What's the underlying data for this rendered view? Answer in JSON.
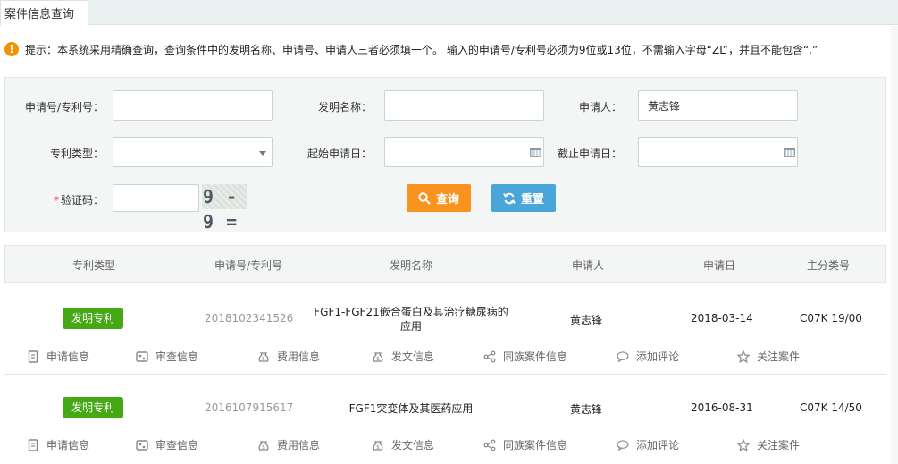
{
  "tab": {
    "label": "案件信息查询"
  },
  "tip": {
    "icon": "warning-icon",
    "text": "提示：本系统采用精确查询，查询条件中的发明名称、申请号、申请人三者必须填一个。 输入的申请号/专利号必须为9位或13位，不需输入字母“ZL”，并且不能包含“.”"
  },
  "form": {
    "app_no_label": "申请号/专利号：",
    "app_no_value": "",
    "invention_label": "发明名称：",
    "invention_value": "",
    "applicant_label": "申请人：",
    "applicant_value": "黄志锋",
    "type_label": "专利类型：",
    "type_selected": "",
    "start_label": "起始申请日：",
    "start_value": "",
    "end_label": "截止申请日：",
    "end_value": "",
    "captcha_required": "*",
    "captcha_label": "验证码：",
    "captcha_value": "",
    "captcha_image": "9 - 9 ="
  },
  "buttons": {
    "search_label": "查询",
    "reset_label": "重置"
  },
  "table": {
    "headers": [
      "专利类型",
      "申请号/专利号",
      "发明名称",
      "申请人",
      "申请日",
      "主分类号"
    ],
    "actions": [
      "申请信息",
      "审查信息",
      "费用信息",
      "发文信息",
      "同族案件信息",
      "添加评论",
      "关注案件"
    ],
    "rows": [
      {
        "type": "发明专利",
        "number": "2018102341526",
        "title": "FGF1-FGF21嵌合蛋白及其治疗糖尿病的应用",
        "applicant": "黄志锋",
        "date": "2018-03-14",
        "class": "C07K 19/00"
      },
      {
        "type": "发明专利",
        "number": "2016107915617",
        "title": "FGF1突变体及其医药应用",
        "applicant": "黄志锋",
        "date": "2016-08-31",
        "class": "C07K 14/50"
      }
    ]
  },
  "colors": {
    "badge": "#45a916",
    "search_button": "#f7931e",
    "reset_button": "#4aa6d8",
    "tip_icon": "#f39200"
  }
}
